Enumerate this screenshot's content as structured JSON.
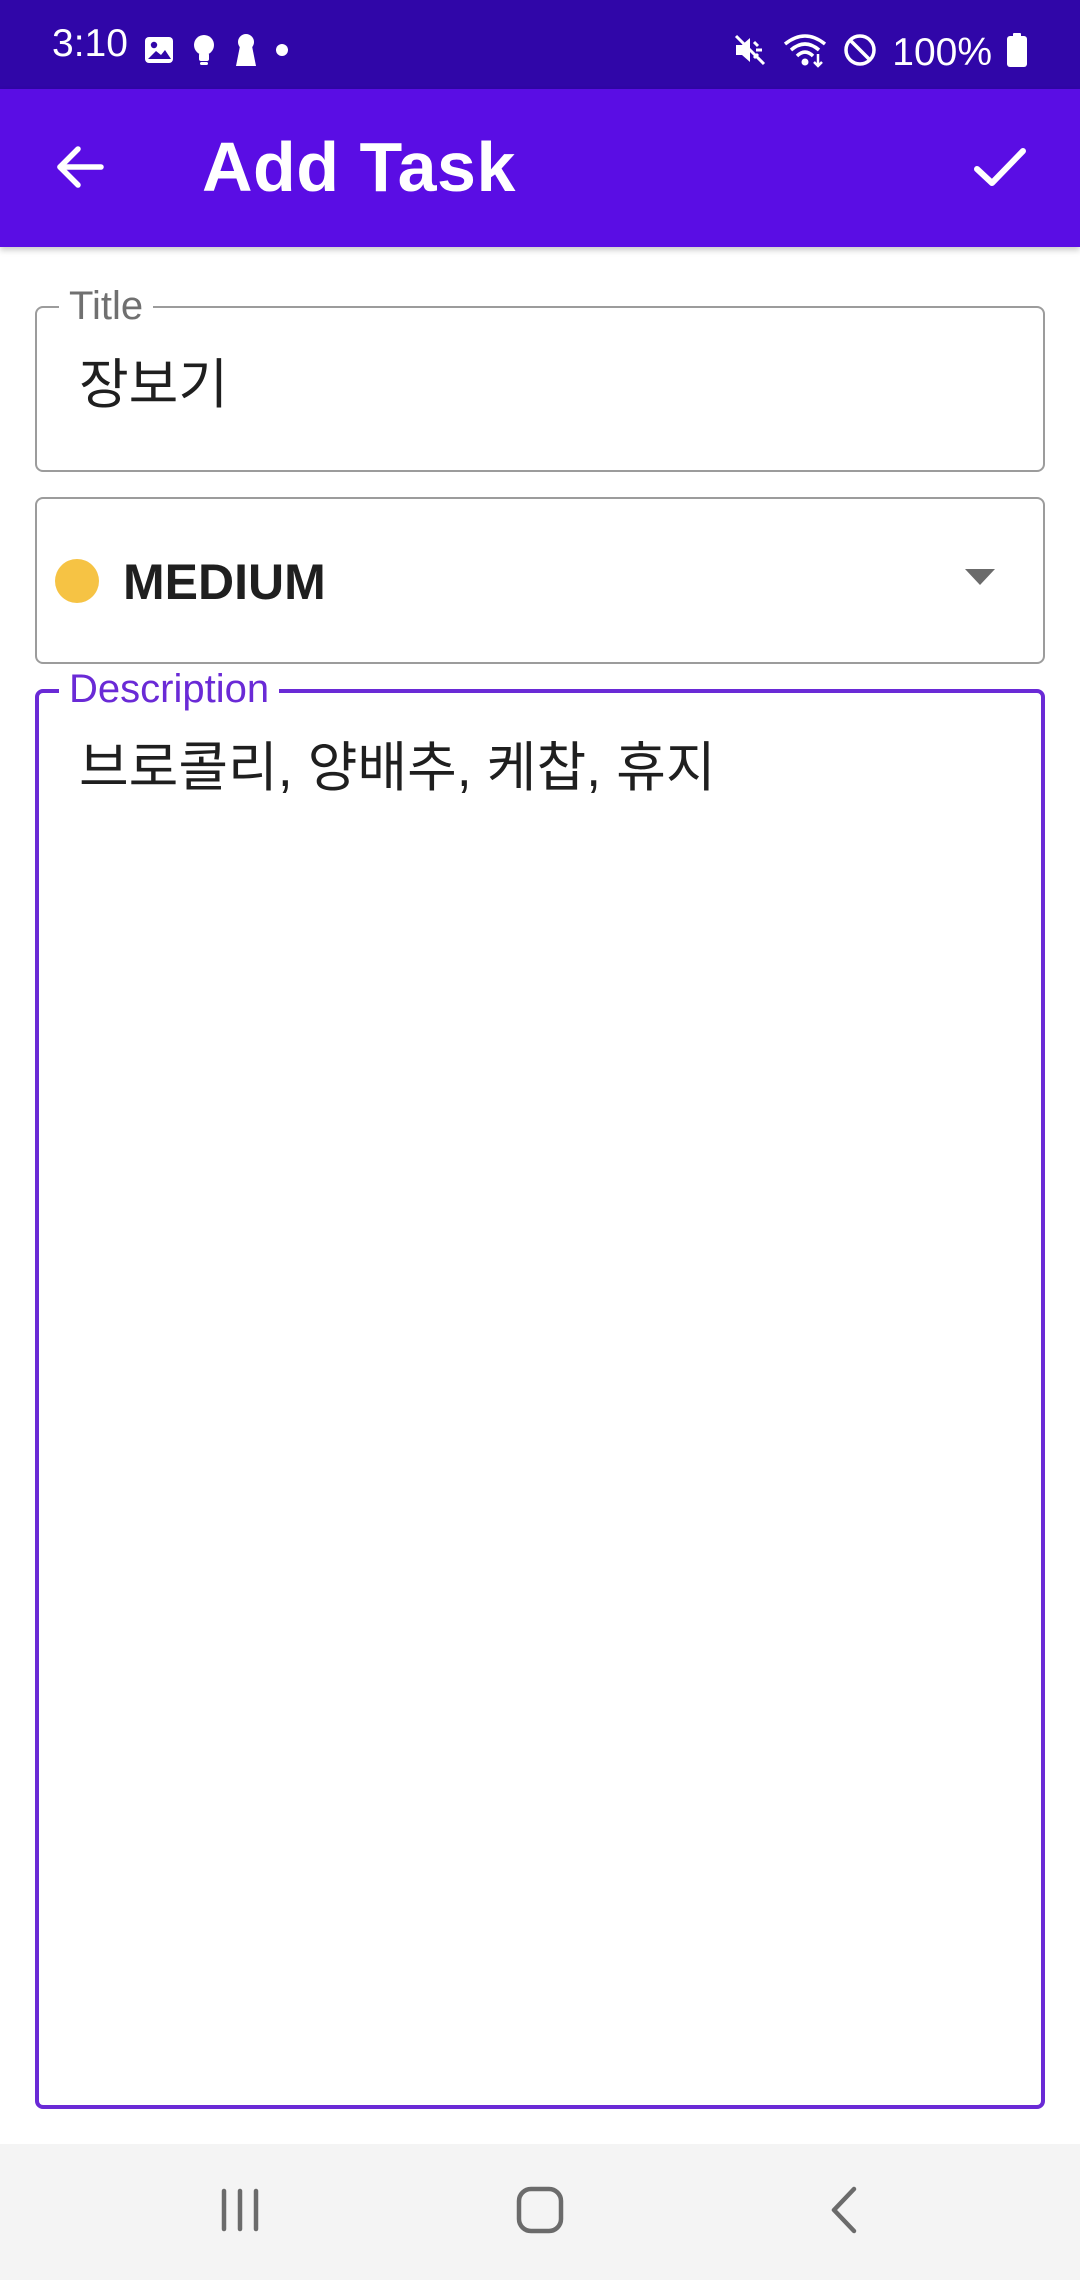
{
  "status_bar": {
    "time": "3:10",
    "battery": "100%",
    "left_icons": [
      "gallery-icon",
      "bulb-icon",
      "keyhole-icon",
      "dot-icon"
    ],
    "right_icons": [
      "mute-icon",
      "wifi-icon",
      "do-not-disturb-icon",
      "battery-icon"
    ]
  },
  "app_bar": {
    "title": "Add Task",
    "back_icon": "arrow-left-icon",
    "confirm_icon": "check-icon"
  },
  "form": {
    "title_field": {
      "label": "Title",
      "value": "장보기"
    },
    "priority_field": {
      "value": "MEDIUM",
      "dot_color": "#f6c344"
    },
    "description_field": {
      "label": "Description",
      "value": "브로콜리, 양배추, 케찹, 휴지",
      "focused": true,
      "accent_color": "#6a2ad6"
    }
  },
  "colors": {
    "status_bar": "#3006a8",
    "app_bar": "#5a0de4",
    "nav_bar": "#f4f4f4"
  },
  "nav_bar": {
    "icons": [
      "recent-apps-icon",
      "home-icon",
      "back-icon"
    ]
  }
}
